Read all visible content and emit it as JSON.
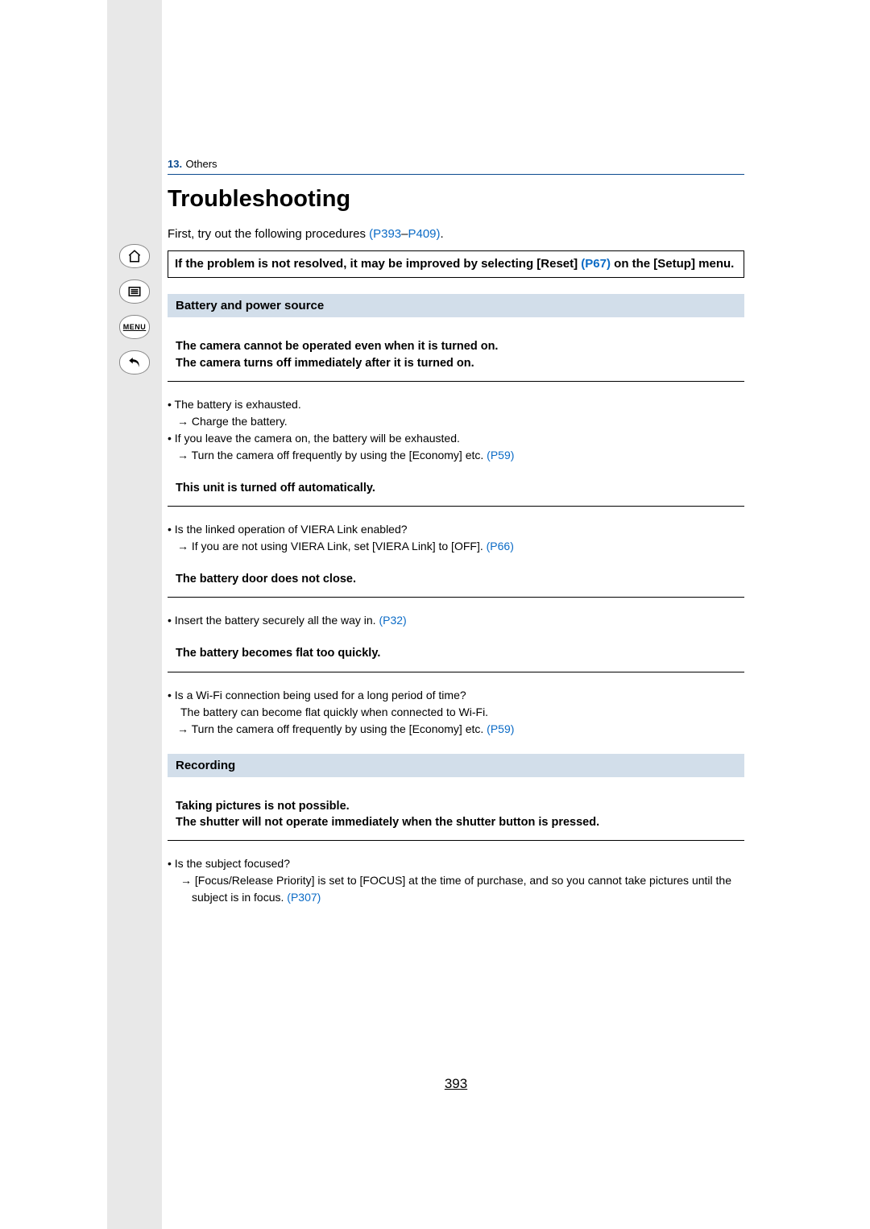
{
  "chapter": {
    "number": "13.",
    "title": "Others"
  },
  "heading": "Troubleshooting",
  "intro": {
    "prefix": "First, try out the following procedures ",
    "link1": "(P393",
    "dash": "–",
    "link2": "P409)",
    "suffix": "."
  },
  "note": {
    "part1": "If the problem is not resolved, it may be improved by selecting [Reset] ",
    "link": "(P67)",
    "part2": " on the [Setup] menu."
  },
  "nav": {
    "menu": "MENU"
  },
  "sections": {
    "battery": {
      "title": "Battery and power source",
      "problems": [
        {
          "title_lines": [
            "The camera cannot be operated even when it is turned on.",
            "The camera turns off immediately after it is turned on."
          ],
          "items": [
            {
              "bullet": "• The battery is exhausted.",
              "arrow": "→ Charge the battery."
            },
            {
              "bullet": "• If you leave the camera on, the battery will be exhausted.",
              "arrow_prefix": "→ Turn the camera off frequently by using the [Economy] etc. ",
              "arrow_link": "(P59)"
            }
          ]
        },
        {
          "title_lines": [
            "This unit is turned off automatically."
          ],
          "items": [
            {
              "bullet": "• Is the linked operation of VIERA Link enabled?",
              "arrow_prefix": "→ If you are not using VIERA Link, set [VIERA Link] to [OFF]. ",
              "arrow_link": "(P66)"
            }
          ]
        },
        {
          "title_lines": [
            "The battery door does not close."
          ],
          "items": [
            {
              "bullet_prefix": "• Insert the battery securely all the way in. ",
              "bullet_link": "(P32)"
            }
          ]
        },
        {
          "title_lines": [
            "The battery becomes flat too quickly."
          ],
          "items": [
            {
              "bullet": "• Is a Wi-Fi connection being used for a long period of time?",
              "sub": "The battery can become flat quickly when connected to Wi-Fi.",
              "arrow_prefix": "→ Turn the camera off frequently by using the [Economy] etc. ",
              "arrow_link": "(P59)"
            }
          ]
        }
      ]
    },
    "recording": {
      "title": "Recording",
      "problems": [
        {
          "title_lines": [
            "Taking pictures is not possible.",
            "The shutter will not operate immediately when the shutter button is pressed."
          ],
          "items": [
            {
              "bullet": "• Is the subject focused?",
              "arrow_prefix": "→ [Focus/Release Priority] is set to [FOCUS] at the time of purchase, and so you cannot take pictures until the subject is in focus. ",
              "arrow_link": "(P307)"
            }
          ]
        }
      ]
    }
  },
  "page_number": "393"
}
